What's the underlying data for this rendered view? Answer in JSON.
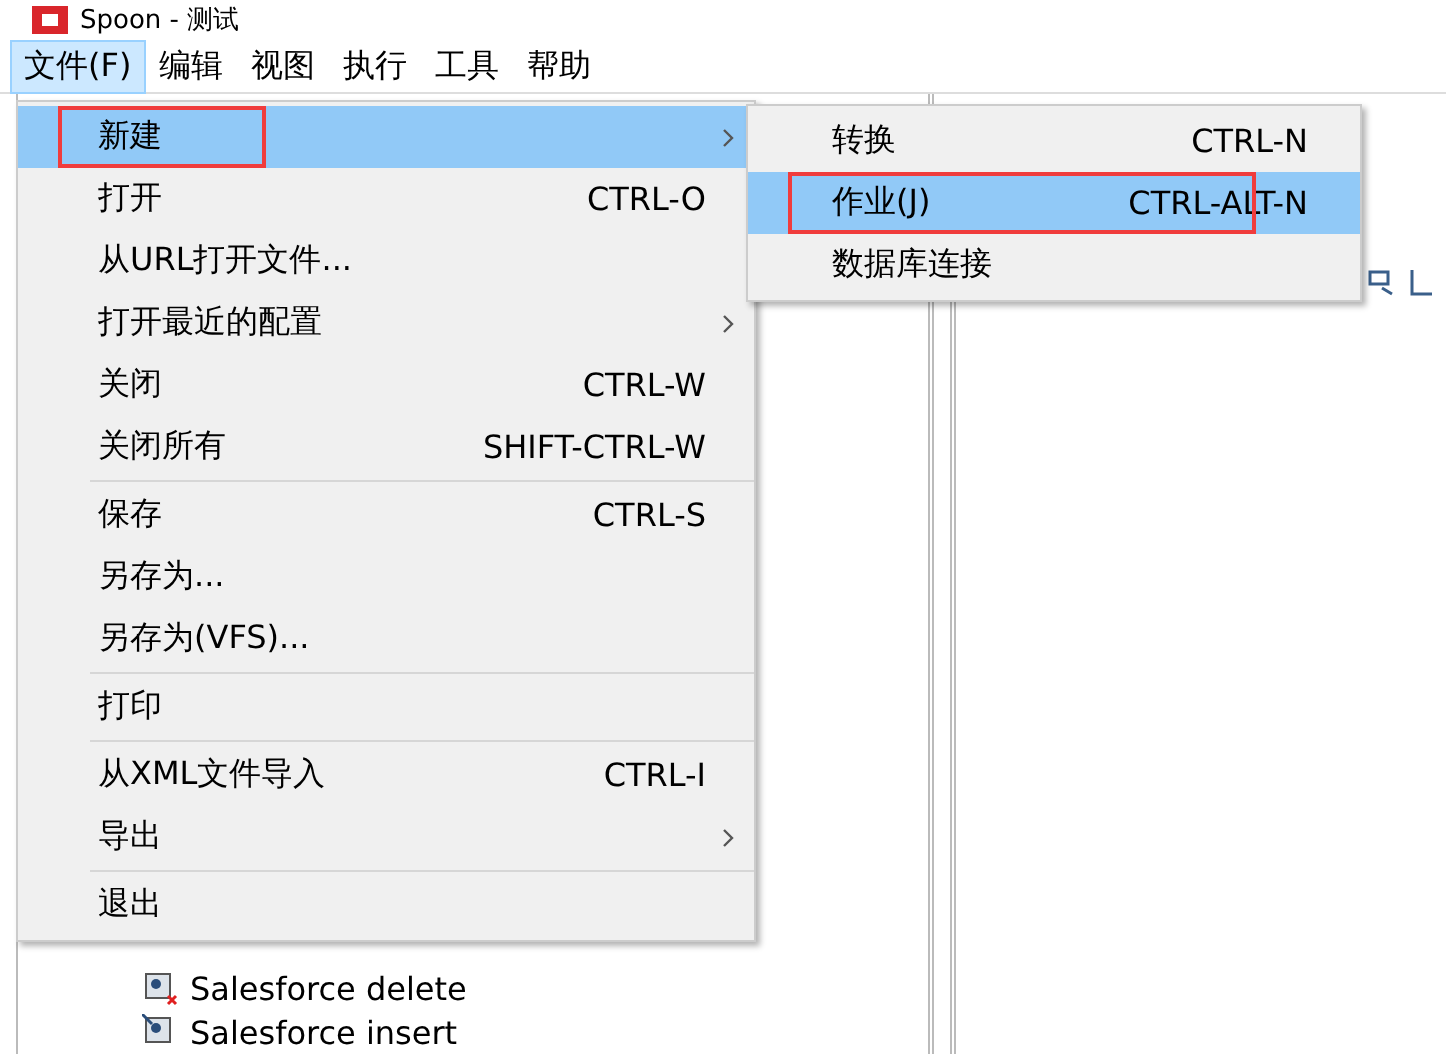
{
  "window": {
    "title": "Spoon - 测试"
  },
  "menubar": [
    {
      "label": "文件(F)",
      "selected": true
    },
    {
      "label": "编辑",
      "selected": false
    },
    {
      "label": "视图",
      "selected": false
    },
    {
      "label": "执行",
      "selected": false
    },
    {
      "label": "工具",
      "selected": false
    },
    {
      "label": "帮助",
      "selected": false
    }
  ],
  "file_menu": [
    {
      "kind": "item",
      "label": "新建",
      "submenu": true,
      "selected": true,
      "annotated": true
    },
    {
      "kind": "item",
      "label": "打开",
      "shortcut": "CTRL-O",
      "submenu": false,
      "selected": false,
      "annotated": false
    },
    {
      "kind": "item",
      "label": "从URL打开文件...",
      "submenu": false,
      "selected": false,
      "annotated": false
    },
    {
      "kind": "item",
      "label": "打开最近的配置",
      "submenu": true,
      "selected": false,
      "annotated": false
    },
    {
      "kind": "item",
      "label": "关闭",
      "shortcut": "CTRL-W",
      "submenu": false,
      "selected": false,
      "annotated": false
    },
    {
      "kind": "item",
      "label": "关闭所有",
      "shortcut": "SHIFT-CTRL-W",
      "submenu": false,
      "selected": false,
      "annotated": false
    },
    {
      "kind": "separator"
    },
    {
      "kind": "item",
      "label": "保存",
      "shortcut": "CTRL-S",
      "submenu": false,
      "selected": false,
      "annotated": false
    },
    {
      "kind": "item",
      "label": "另存为...",
      "submenu": false,
      "selected": false,
      "annotated": false
    },
    {
      "kind": "item",
      "label": "另存为(VFS)...",
      "submenu": false,
      "selected": false,
      "annotated": false
    },
    {
      "kind": "separator"
    },
    {
      "kind": "item",
      "label": "打印",
      "submenu": false,
      "selected": false,
      "annotated": false
    },
    {
      "kind": "separator"
    },
    {
      "kind": "item",
      "label": "从XML文件导入",
      "shortcut": "CTRL-I",
      "submenu": false,
      "selected": false,
      "annotated": false
    },
    {
      "kind": "item",
      "label": "导出",
      "submenu": true,
      "selected": false,
      "annotated": false
    },
    {
      "kind": "separator"
    },
    {
      "kind": "item",
      "label": "退出",
      "submenu": false,
      "selected": false,
      "annotated": false
    }
  ],
  "new_submenu": [
    {
      "label": "转换",
      "shortcut": "CTRL-N",
      "selected": false,
      "annotated": false
    },
    {
      "label": "作业(J)",
      "shortcut": "CTRL-ALT-N",
      "selected": true,
      "annotated": true
    },
    {
      "label": "数据库连接",
      "selected": false,
      "annotated": false
    }
  ],
  "tree": [
    {
      "label": "Salesforce delete",
      "kind": "delete"
    },
    {
      "label": "Salesforce insert",
      "kind": "insert"
    }
  ]
}
